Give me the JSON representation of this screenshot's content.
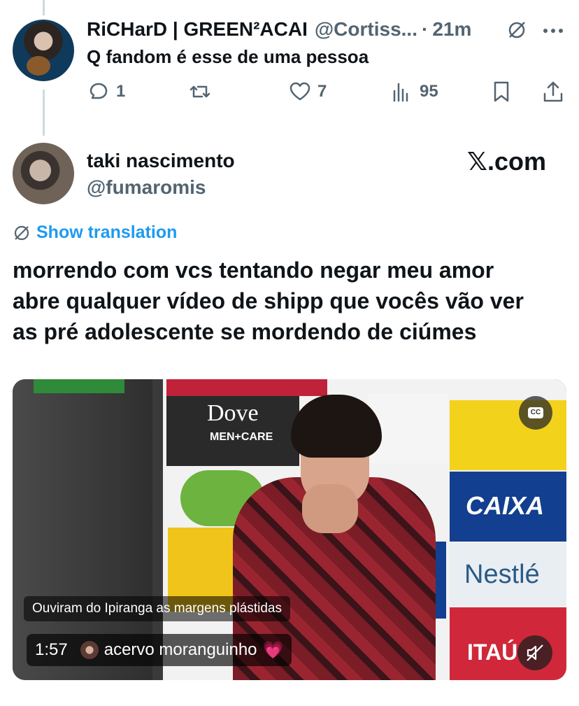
{
  "reply_tweet": {
    "author_name": "RiCHarD | GREEN²ACAI",
    "author_handle": "@Cortiss...",
    "separator": "·",
    "time": "21m",
    "text": "Q fandom é esse de uma pessoa",
    "metrics": {
      "replies": "1",
      "reposts": "",
      "likes": "7",
      "views": "95"
    },
    "icons": {
      "grok": "grok-icon",
      "more": "more-dots-icon",
      "reply": "reply-bubble-icon",
      "repost": "repost-icon",
      "like": "heart-icon",
      "views": "bar-chart-icon",
      "bookmark": "bookmark-icon",
      "share": "share-icon"
    }
  },
  "main_tweet": {
    "author_name": "taki nascimento",
    "author_handle": "@fumaromis",
    "watermark": "𝕏.com",
    "show_translation": "Show translation",
    "text_lines": [
      "morrendo com vcs tentando negar meu amor",
      "abre qualquer vídeo de shipp que vocês vão ver",
      "as pré adolescente se mordendo de ciúmes"
    ]
  },
  "video": {
    "sponsors": [
      "Dove",
      "MEN+CARE",
      "CAIXA",
      "Nestlé",
      "ITAÚ"
    ],
    "caption": "Ouviram do Ipiranga as margens plástidas",
    "duration": "1:57",
    "channel": "acervo moranguinho",
    "channel_emoji": "💗",
    "cc_label": "CC"
  },
  "colors": {
    "link_blue": "#1d9bf0",
    "secondary_text": "#536471",
    "primary_text": "#0f1419",
    "thread_line": "#cfd9de"
  }
}
